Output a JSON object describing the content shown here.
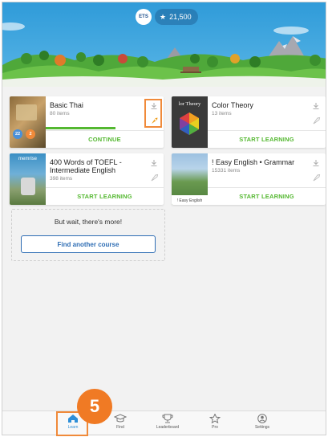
{
  "header": {
    "avatar_text": "ETS",
    "points": "21,500",
    "sky_color": "#3aa3de"
  },
  "courses": [
    {
      "title": "Basic Thai",
      "items": "80 items",
      "action": "CONTINUE",
      "progress": 0.62,
      "badges": [
        "22",
        "2"
      ]
    },
    {
      "title": "Color Theory",
      "thumb_caption": "lor Theory",
      "items": "13 items",
      "action": "START LEARNING"
    },
    {
      "title_line1": "400 Words of TOEFL -",
      "title_line2": "Intermediate English",
      "thumb_caption": "memrise",
      "items": "398 items",
      "action": "START LEARNING"
    },
    {
      "title": "! Easy English • Grammar",
      "thumb_caption": "! Easy English",
      "items": "15331 items",
      "action": "START LEARNING"
    }
  ],
  "more": {
    "text": "But wait, there's more!",
    "button": "Find another course"
  },
  "nav": {
    "learn": "Learn",
    "find": "Find",
    "leaderboard": "Leaderboard",
    "pro": "Pro",
    "settings": "Settings"
  },
  "callout_number": "5",
  "colors": {
    "accent_green": "#54b830",
    "highlight_orange": "#f08a3a",
    "link_blue": "#2e6db4"
  }
}
